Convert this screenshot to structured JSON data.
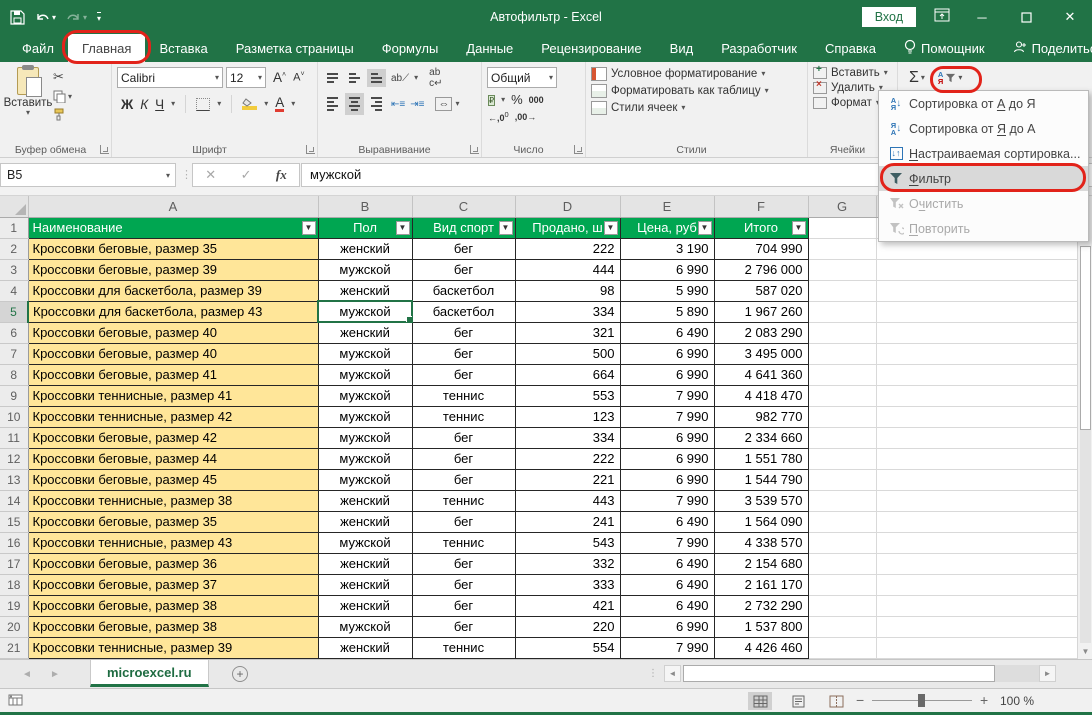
{
  "window": {
    "title": "Автофильтр  -  Excel",
    "sign_in_label": "Вход"
  },
  "tabs": {
    "file": "Файл",
    "home": "Главная",
    "insert": "Вставка",
    "layout": "Разметка страницы",
    "formulas": "Формулы",
    "data": "Данные",
    "review": "Рецензирование",
    "view": "Вид",
    "developer": "Разработчик",
    "help": "Справка",
    "assistant": "Помощник",
    "share": "Поделиться"
  },
  "ribbon": {
    "paste_label": "Вставить",
    "clipboard_group": "Буфер обмена",
    "font_name": "Calibri",
    "font_size": "12",
    "bold": "Ж",
    "italic": "К",
    "underline": "Ч",
    "font_group": "Шрифт",
    "alignment_group": "Выравнивание",
    "number_format": "Общий",
    "number_group": "Число",
    "conditional_formatting": "Условное форматирование",
    "format_as_table": "Форматировать как таблицу",
    "cell_styles": "Стили ячеек",
    "styles_group": "Стили",
    "insert_cells": "Вставить",
    "delete_cells": "Удалить",
    "format_cells": "Формат",
    "cells_group": "Ячейки",
    "percent": "%",
    "thousands": "000"
  },
  "formula_bar": {
    "name_box": "B5",
    "value": "мужской"
  },
  "sort_menu": {
    "items": [
      {
        "pre": "Сортировка от ",
        "key": "А",
        "post": " до Я",
        "icon": "sort-az-icon",
        "enabled": true,
        "highlighted": false
      },
      {
        "pre": "Сортировка от ",
        "key": "Я",
        "post": " до А",
        "icon": "sort-za-icon",
        "enabled": true,
        "highlighted": false
      },
      {
        "pre": "",
        "key": "Н",
        "post": "астраиваемая сортировка...",
        "icon": "custom-sort-icon",
        "enabled": true,
        "highlighted": false
      },
      {
        "pre": "",
        "key": "Ф",
        "post": "ильтр",
        "icon": "filter-icon",
        "enabled": true,
        "highlighted": true
      },
      {
        "pre": "О",
        "key": "ч",
        "post": "истить",
        "icon": "clear-filter-icon",
        "enabled": false,
        "highlighted": false
      },
      {
        "pre": "",
        "key": "П",
        "post": "овторить",
        "icon": "reapply-icon",
        "enabled": false,
        "highlighted": false
      }
    ]
  },
  "grid": {
    "column_letters": [
      "A",
      "B",
      "C",
      "D",
      "E",
      "F",
      "G"
    ],
    "selected_cell": "B5",
    "header_row": [
      "Наименование",
      "Пол",
      "Вид спорт",
      "Продано, ш",
      "Цена, руб",
      "Итого"
    ],
    "rows": [
      [
        "2",
        "Кроссовки беговые, размер 35",
        "женский",
        "бег",
        "222",
        "3 190",
        "704 990"
      ],
      [
        "3",
        "Кроссовки беговые, размер 39",
        "мужской",
        "бег",
        "444",
        "6 990",
        "2 796 000"
      ],
      [
        "4",
        "Кроссовки для баскетбола, размер 39",
        "женский",
        "баскетбол",
        "98",
        "5 990",
        "587 020"
      ],
      [
        "5",
        "Кроссовки для баскетбола, размер 43",
        "мужской",
        "баскетбол",
        "334",
        "5 890",
        "1 967 260"
      ],
      [
        "6",
        "Кроссовки беговые, размер 40",
        "женский",
        "бег",
        "321",
        "6 490",
        "2 083 290"
      ],
      [
        "7",
        "Кроссовки беговые, размер 40",
        "мужской",
        "бег",
        "500",
        "6 990",
        "3 495 000"
      ],
      [
        "8",
        "Кроссовки беговые, размер 41",
        "мужской",
        "бег",
        "664",
        "6 990",
        "4 641 360"
      ],
      [
        "9",
        "Кроссовки теннисные, размер 41",
        "мужской",
        "теннис",
        "553",
        "7 990",
        "4 418 470"
      ],
      [
        "10",
        "Кроссовки теннисные, размер 42",
        "мужской",
        "теннис",
        "123",
        "7 990",
        "982 770"
      ],
      [
        "11",
        "Кроссовки беговые, размер 42",
        "мужской",
        "бег",
        "334",
        "6 990",
        "2 334 660"
      ],
      [
        "12",
        "Кроссовки беговые, размер 44",
        "мужской",
        "бег",
        "222",
        "6 990",
        "1 551 780"
      ],
      [
        "13",
        "Кроссовки беговые, размер 45",
        "мужской",
        "бег",
        "221",
        "6 990",
        "1 544 790"
      ],
      [
        "14",
        "Кроссовки теннисные, размер 38",
        "женский",
        "теннис",
        "443",
        "7 990",
        "3 539 570"
      ],
      [
        "15",
        "Кроссовки беговые, размер 35",
        "женский",
        "бег",
        "241",
        "6 490",
        "1 564 090"
      ],
      [
        "16",
        "Кроссовки теннисные, размер 43",
        "мужской",
        "теннис",
        "543",
        "7 990",
        "4 338 570"
      ],
      [
        "17",
        "Кроссовки беговые, размер 36",
        "женский",
        "бег",
        "332",
        "6 490",
        "2 154 680"
      ],
      [
        "18",
        "Кроссовки беговые, размер 37",
        "женский",
        "бег",
        "333",
        "6 490",
        "2 161 170"
      ],
      [
        "19",
        "Кроссовки беговые, размер 38",
        "женский",
        "бег",
        "421",
        "6 490",
        "2 732 290"
      ],
      [
        "20",
        "Кроссовки беговые, размер 38",
        "мужской",
        "бег",
        "220",
        "6 990",
        "1 537 800"
      ],
      [
        "21",
        "Кроссовки теннисные, размер 39",
        "женский",
        "теннис",
        "554",
        "7 990",
        "4 426 460"
      ]
    ]
  },
  "sheet": {
    "tab_name": "microexcel.ru"
  },
  "status_bar": {
    "zoom_level": "100 %"
  },
  "colors": {
    "title_green": "#217346",
    "table_header_green": "#00A651",
    "column_a_fill": "#FFE699",
    "annotation_red": "#E2231A"
  }
}
